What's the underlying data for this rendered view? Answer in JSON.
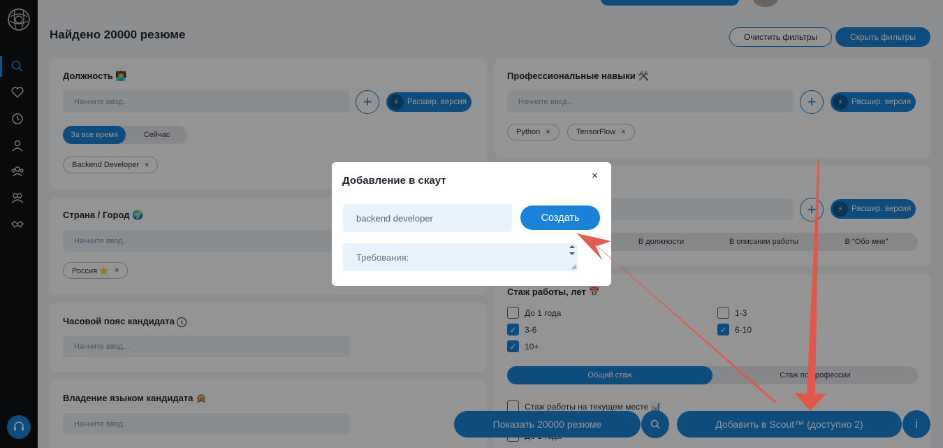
{
  "page": {
    "title": "Найдено 20000 резюме",
    "clear_filters": "Очистить фильтры",
    "hide_filters": "Скрыть фильтры"
  },
  "position_card": {
    "title": "Должность 👨‍💻",
    "placeholder": "Начните ввод...",
    "ext_label": "Расшир. версия",
    "time_options": [
      "За все время",
      "Сейчас"
    ],
    "time_selected": "За все время",
    "chips": [
      "Backend Developer"
    ]
  },
  "skills_card": {
    "title": "Профессиональные навыки 🛠️",
    "placeholder": "Начните ввод...",
    "ext_label": "Расшир. версия",
    "chips": [
      "Python",
      "TensorFlow"
    ]
  },
  "keywords_card": {
    "ext_label": "Расшир. версия",
    "search_in": [
      "В должности",
      "В описании работы",
      "В \"Обо мне\""
    ]
  },
  "country_card": {
    "title": "Страна / Город 🌍",
    "placeholder": "Начните ввод...",
    "chips": [
      "Россия ⭐"
    ]
  },
  "timezone_card": {
    "title": "Часовой пояс кандидата",
    "info": "i",
    "placeholder": "Начните ввод..."
  },
  "language_card": {
    "title": "Владение языком кандидата 🙊",
    "placeholder": "Начните ввод..."
  },
  "experience_card": {
    "title": "Стаж работы, лет 📅",
    "options": [
      {
        "label": "До 1 года",
        "checked": false
      },
      {
        "label": "1-3",
        "checked": false
      },
      {
        "label": "3-6",
        "checked": true
      },
      {
        "label": "6-10",
        "checked": true
      },
      {
        "label": "10+",
        "checked": true
      }
    ],
    "mode_options": [
      "Общий стаж",
      "Стаж по профессии"
    ],
    "mode_selected": "Общий стаж",
    "current_place": "Стаж работы на текущем месте 📊",
    "partial_below": "До 1 года"
  },
  "bottom_bar": {
    "show_results": "Показать 20000 резюме",
    "add_to_scout": "Добавить в Scout™ (доступно 2)",
    "info": "i"
  },
  "modal": {
    "title": "Добавление в скаут",
    "close": "×",
    "name_value": "backend developer",
    "create_label": "Создать",
    "requirements_placeholder": "Требования:"
  },
  "colors": {
    "accent": "#1a83d9",
    "sidebar": "#111213",
    "annotation_arrow": "#e2574a"
  },
  "sidebar": {
    "icons": [
      "search-icon",
      "heart-icon",
      "history-icon",
      "user-icon",
      "group-icon",
      "team-icon",
      "handshake-icon"
    ],
    "support_icon": "headset-icon"
  }
}
